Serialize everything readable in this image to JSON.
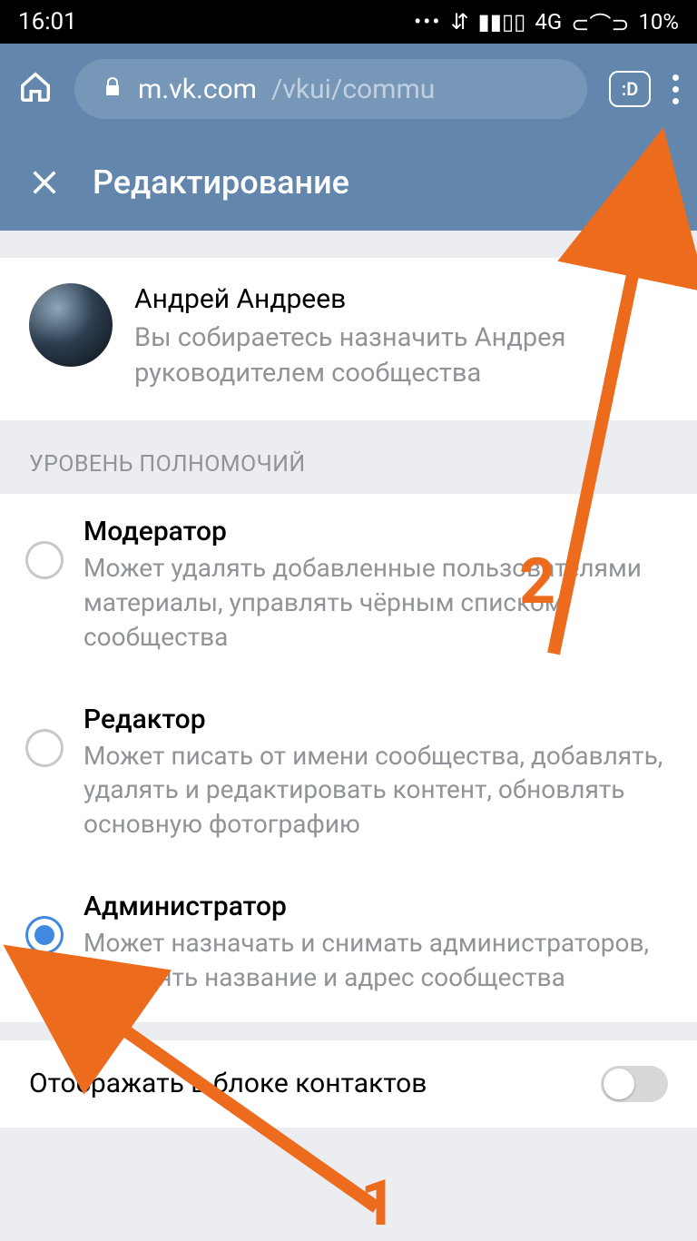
{
  "status": {
    "time": "16:01",
    "net": "4G",
    "battery": "10%"
  },
  "browser": {
    "domain": "m.vk.com",
    "path": "/vkui/commu",
    "tabs": ":D"
  },
  "header": {
    "title": "Редактирование"
  },
  "user": {
    "name": "Андрей Андреев",
    "desc": "Вы собираетесь назначить Андрея руководителем сообщества"
  },
  "section_title": "УРОВЕНЬ ПОЛНОМОЧИЙ",
  "roles": [
    {
      "title": "Модератор",
      "desc": "Может удалять добавленные пользователями материалы, управлять чёрным списком сообщества",
      "selected": false
    },
    {
      "title": "Редактор",
      "desc": "Может писать от имени сообщества, добавлять, удалять и редактировать контент, обновлять основную фотографию",
      "selected": false
    },
    {
      "title": "Администратор",
      "desc": "Может назначать и снимать администраторов, изменять название и адрес сообщества",
      "selected": true
    }
  ],
  "toggle": {
    "label": "Отображать в блоке контактов"
  },
  "annotations": {
    "one": "1",
    "two": "2"
  }
}
